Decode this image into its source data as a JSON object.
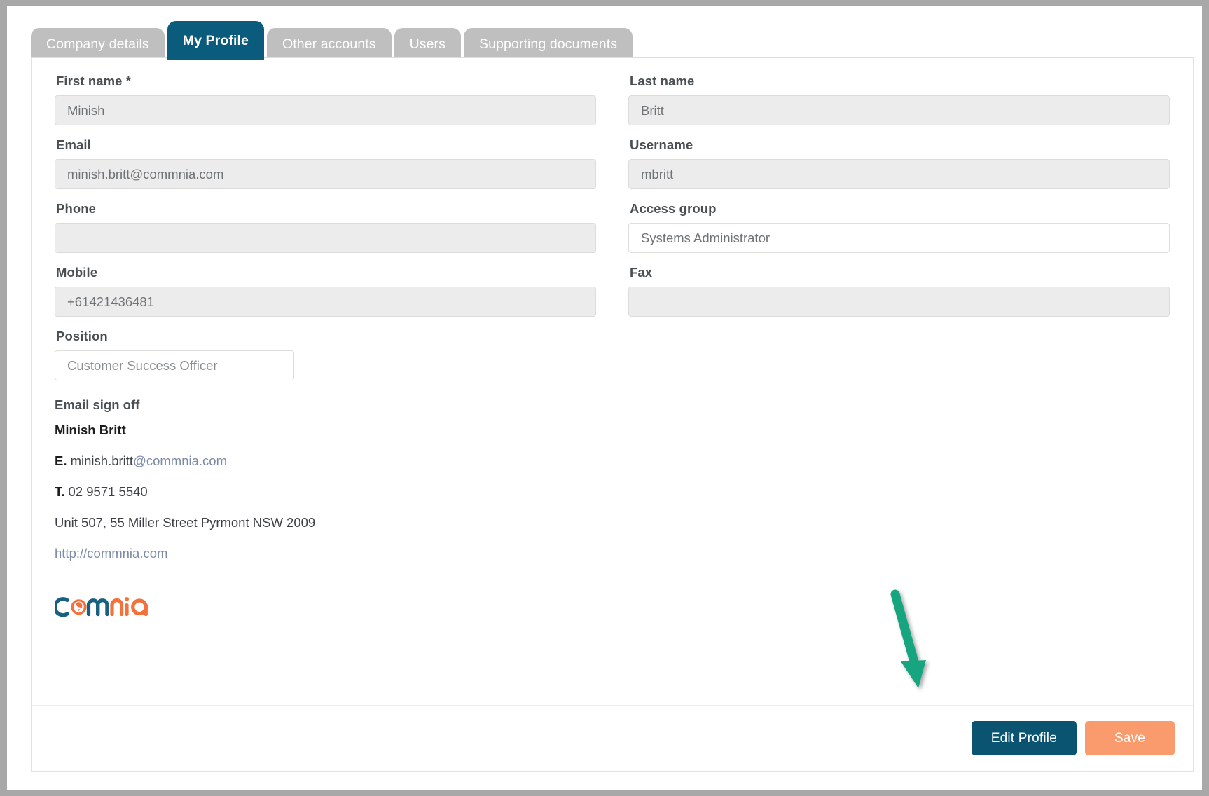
{
  "tabs": [
    {
      "label": "Company details",
      "active": false
    },
    {
      "label": "My Profile",
      "active": true
    },
    {
      "label": "Other accounts",
      "active": false
    },
    {
      "label": "Users",
      "active": false
    },
    {
      "label": "Supporting documents",
      "active": false
    }
  ],
  "form": {
    "first_name": {
      "label": "First name *",
      "value": "Minish",
      "editable": false
    },
    "last_name": {
      "label": "Last name",
      "value": "Britt",
      "editable": false
    },
    "email": {
      "label": "Email",
      "value": "minish.britt@commnia.com",
      "editable": false
    },
    "username": {
      "label": "Username",
      "value": "mbritt",
      "editable": false
    },
    "phone": {
      "label": "Phone",
      "value": "",
      "editable": false
    },
    "access_group": {
      "label": "Access group",
      "value": "Systems Administrator",
      "editable": true
    },
    "mobile": {
      "label": "Mobile",
      "value": "+61421436481",
      "editable": false
    },
    "fax": {
      "label": "Fax",
      "value": "",
      "editable": false
    },
    "position": {
      "label": "Position",
      "value": "Customer Success Officer",
      "editable": true
    }
  },
  "signature": {
    "label": "Email sign off",
    "name": "Minish Britt",
    "email_prefix": "E.",
    "email_local": "minish.britt",
    "email_domain": "@commnia.com",
    "phone_prefix": "T.",
    "phone": "02 9571 5540",
    "address": "Unit 507, 55 Miller Street Pyrmont NSW 2009",
    "url": "http://commnia.com"
  },
  "logo": {
    "name": "commnia",
    "part_dark_1": "c",
    "part_mark": "o",
    "part_dark_2": "mm",
    "part_orange": "nia",
    "color_dark": "#17607f",
    "color_orange": "#f4713c"
  },
  "footer": {
    "edit_label": "Edit Profile",
    "save_label": "Save"
  },
  "annotation": {
    "arrow_color": "#17a57f",
    "points_to": "Edit Profile"
  },
  "colors": {
    "active_tab": "#0b5b7c",
    "inactive_tab": "#bfbfbf",
    "edit_button": "#0b5471",
    "save_button": "#fa9b6e",
    "disabled_field": "#ececec",
    "link": "#7b8aa6"
  }
}
